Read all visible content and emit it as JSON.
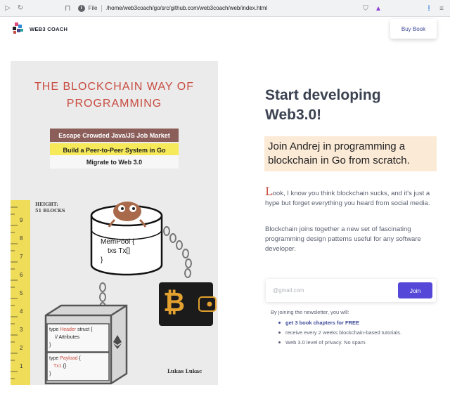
{
  "browser": {
    "file_label": "File",
    "url": "/home/web3coach/go/src/github.com/web3coach/web/index.html"
  },
  "header": {
    "brand": "WEB3 COACH",
    "buy_button": "Buy Book"
  },
  "cover": {
    "title_line1": "THE BLOCKCHAIN WAY OF",
    "title_line2": "PROGRAMMING",
    "band1": "Escape Crowded Java/JS Job Market",
    "band2": "Build a Peer-to-Peer System in Go",
    "band3": "Migrate to Web 3.0",
    "height_label_line1": "HEIGHT:",
    "height_label_line2": "51 BLOCKS",
    "mempool_line1": "MemPool {",
    "mempool_line2": "txs  Tx[]",
    "mempool_line3": "}",
    "header_line1_a": "type ",
    "header_line1_b": "Header",
    "header_line1_c": " struct {",
    "header_line2": "// Attributes",
    "header_line3": "}",
    "payload_line1_a": "type ",
    "payload_line1_b": "Payload",
    "payload_line1_c": " {",
    "payload_line2_a": "Tx1",
    "payload_line2_b": " {}",
    "payload_line3": "}",
    "bitcoin_symbol": "₿",
    "ruler_numbers": [
      "9",
      "8",
      "7",
      "6",
      "5",
      "4",
      "3",
      "2",
      "1"
    ],
    "author": "Lukas Lukac"
  },
  "hero": {
    "title_line1": "Start developing",
    "title_line2": "Web3.0!",
    "highlight": "Join Andrej in programming a blockchain in Go from scratch.",
    "para1_dropcap": "L",
    "para1_rest": "ook, I know you think blockchain sucks, and it's just a hype but forget everything you heard from social media.",
    "para2": "Blockchain joins together a new set of fascinating programming design patterns useful for any software developer."
  },
  "newsletter": {
    "placeholder": "@gmail.com",
    "join_button": "Join",
    "intro": "By joining the newsletter, you will:",
    "benefits": [
      "get 3 book chapters for FREE",
      "receive every 2 weeks blockchain-based tutorials.",
      "Web 3.0 level of privacy. No spam."
    ]
  },
  "colors": {
    "accent": "#5548d9",
    "cover_title": "#c84b40",
    "highlight_bg": "#fbead6"
  }
}
